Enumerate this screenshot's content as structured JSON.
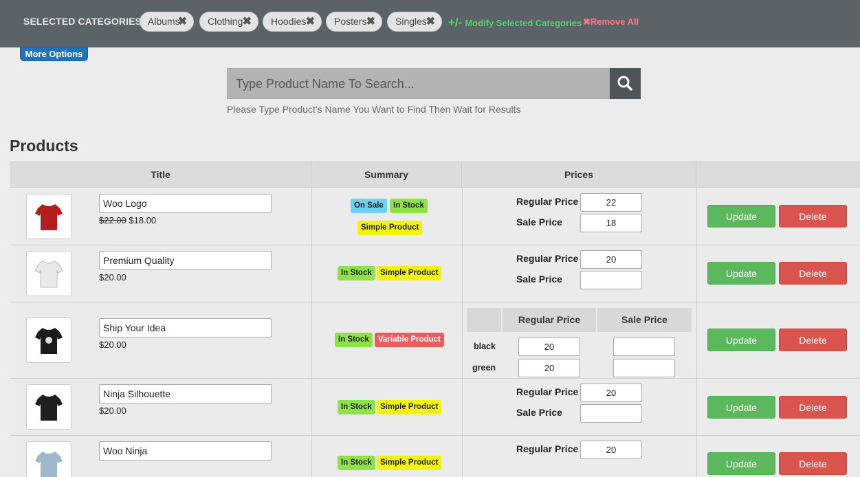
{
  "top_bar": {
    "label": "SELECTED CATEGORIES:",
    "chips": [
      "Albums",
      "Clothing",
      "Hoodies",
      "Posters",
      "Singles"
    ],
    "chip_remove": "✖",
    "modify_sign": "+/-",
    "modify_label": "Modify Selected Categories",
    "remove_all_label": "✖Remove All"
  },
  "more_options_label": "More Options",
  "search": {
    "placeholder": "Type Product Name To Search...",
    "hint": "Please Type Product's Name You Want to Find Then Wait for Results",
    "icon": "search-icon"
  },
  "section_title": "Products",
  "table": {
    "headers": [
      "Title",
      "Summary",
      "Prices",
      ""
    ],
    "update_label": "Update",
    "delete_label": "Delete",
    "regular_price_label": "Regular Price",
    "sale_price_label": "Sale Price",
    "rows": [
      {
        "name": "Woo Logo",
        "old_price": "$22.00",
        "price": "$18.00",
        "badges": [
          "On Sale",
          "In Stock",
          "Simple Product"
        ],
        "regular_price": "22",
        "sale_price": "18",
        "shirt_color": "#b51d1d"
      },
      {
        "name": "Premium Quality",
        "price": "$20.00",
        "badges": [
          "In Stock",
          "Simple Product"
        ],
        "regular_price": "20",
        "sale_price": "",
        "shirt_color": "#e9e9e9"
      },
      {
        "name": "Ship Your Idea",
        "price": "$20.00",
        "badges": [
          "In Stock",
          "Variable Product"
        ],
        "variations": [
          {
            "label": "black",
            "regular_price": "20",
            "sale_price": ""
          },
          {
            "label": "green",
            "regular_price": "20",
            "sale_price": ""
          }
        ],
        "shirt_color": "#1a1a1a"
      },
      {
        "name": "Ninja Silhouette",
        "price": "$20.00",
        "badges": [
          "In Stock",
          "Simple Product"
        ],
        "regular_price": "20",
        "sale_price": "",
        "shirt_color": "#1f1f1f"
      },
      {
        "name": "Woo Ninja",
        "badges": [
          "In Stock",
          "Simple Product"
        ],
        "regular_price": "20",
        "shirt_color": "#9fb8cc"
      }
    ]
  },
  "colors": {
    "top_bar": "#5b6268",
    "accent_blue": "#1e73be",
    "update_green": "#5cb85c",
    "delete_red": "#d9534f"
  }
}
